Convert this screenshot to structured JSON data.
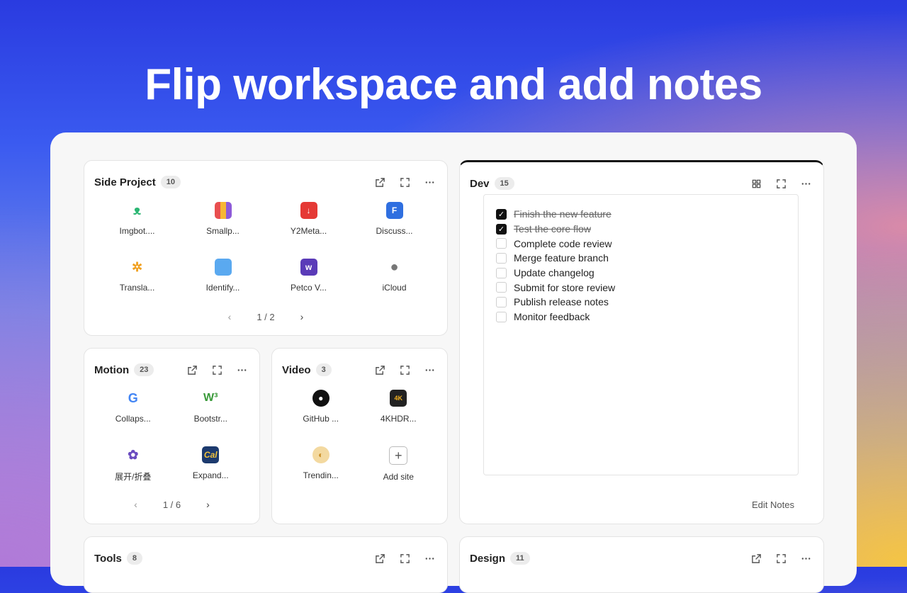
{
  "headline": "Flip workspace and add notes",
  "colors": {
    "panel_bg": "#f7f7f7",
    "card_bg": "#ffffff",
    "dev_top_border": "#111111"
  },
  "cards": {
    "side_project": {
      "title": "Side Project",
      "count": "10",
      "items": [
        {
          "label": "Imgbot....",
          "icon": "imgbot-icon"
        },
        {
          "label": "Smallp...",
          "icon": "smallpdf-icon"
        },
        {
          "label": "Y2Meta...",
          "icon": "y2meta-icon"
        },
        {
          "label": "Discuss...",
          "icon": "discuss-icon"
        },
        {
          "label": "Transla...",
          "icon": "translate-icon"
        },
        {
          "label": "Identify...",
          "icon": "identify-icon"
        },
        {
          "label": "Petco V...",
          "icon": "petco-icon"
        },
        {
          "label": "iCloud",
          "icon": "apple-icon"
        }
      ],
      "pager": "1 / 2"
    },
    "motion": {
      "title": "Motion",
      "count": "23",
      "items": [
        {
          "label": "Collaps...",
          "icon": "google-icon"
        },
        {
          "label": "Bootstr...",
          "icon": "w3-icon"
        },
        {
          "label": "展开/折叠",
          "icon": "dots-ring-icon"
        },
        {
          "label": "Expand...",
          "icon": "cal-icon"
        }
      ],
      "pager": "1 / 6"
    },
    "video": {
      "title": "Video",
      "count": "3",
      "items": [
        {
          "label": "GitHub ...",
          "icon": "github-icon"
        },
        {
          "label": "4KHDR...",
          "icon": "4khdr-icon"
        },
        {
          "label": "Trendin...",
          "icon": "trending-icon"
        },
        {
          "label": "Add site",
          "icon": "plus-icon"
        }
      ]
    },
    "dev": {
      "title": "Dev",
      "count": "15",
      "todos": [
        {
          "text": "Finish the new feature",
          "done": true
        },
        {
          "text": "Test the core flow",
          "done": true
        },
        {
          "text": "Complete code review",
          "done": false
        },
        {
          "text": "Merge feature branch",
          "done": false
        },
        {
          "text": "Update changelog",
          "done": false
        },
        {
          "text": "Submit for store review",
          "done": false
        },
        {
          "text": "Publish release notes",
          "done": false
        },
        {
          "text": "Monitor feedback",
          "done": false
        }
      ],
      "edit_label": "Edit Notes"
    },
    "tools": {
      "title": "Tools",
      "count": "8"
    },
    "design": {
      "title": "Design",
      "count": "11"
    }
  }
}
